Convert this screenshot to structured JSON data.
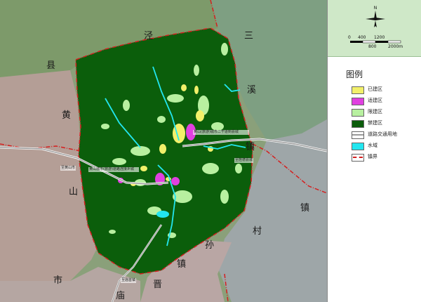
{
  "map": {
    "place_labels": {
      "jing": "泾",
      "san": "三",
      "xian": "县",
      "xi": "溪",
      "huang": "黄",
      "shan": "山",
      "zhen_right": "镇",
      "zhen_right2": "镇",
      "cun": "村",
      "sun": "孙",
      "zhen_bottom": "镇",
      "shi": "市",
      "jin": "晋",
      "miao": "庙"
    },
    "road_labels": {
      "road_top_right": "黄山(旅游)城市二干道到县城",
      "road_left": "黄山城市(旅游)道路连接乡城",
      "town_right": "至旌德县城",
      "town_left": "至黄山市",
      "town_bottom": "至庙首镇"
    }
  },
  "legend": {
    "title": "图例",
    "items": [
      {
        "label": "已建区",
        "color": "#f2f06a"
      },
      {
        "label": "适建区",
        "color": "#e040e0"
      },
      {
        "label": "限建区",
        "color": "#b8f0a0"
      },
      {
        "label": "禁建区",
        "color": "#0a5c0a"
      },
      {
        "label": "道路交通用地",
        "color": "#d0d0d0"
      },
      {
        "label": "水域",
        "color": "#22e6f0"
      },
      {
        "label": "镇界",
        "color": "#d42020"
      }
    ]
  },
  "compass": {
    "north_label": "N"
  },
  "scale": {
    "top_ticks": [
      "0",
      "400",
      "1200"
    ],
    "bottom_ticks": [
      "800",
      "2000m"
    ]
  }
}
